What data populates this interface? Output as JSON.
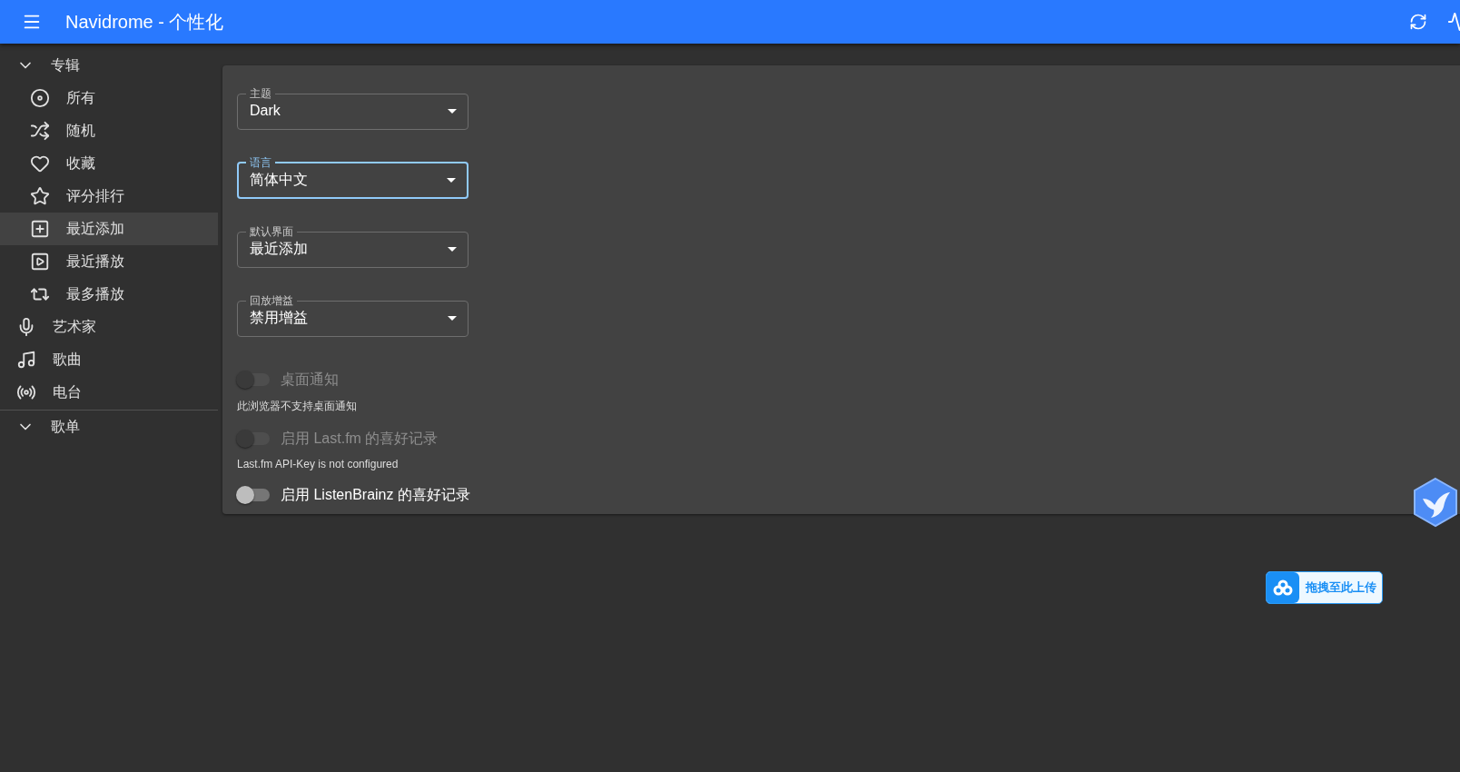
{
  "app_bar": {
    "title": "Navidrome - 个性化"
  },
  "sidebar": {
    "items": [
      {
        "label": "专辑",
        "kind": "group",
        "selected": false,
        "children": [
          {
            "label": "所有",
            "selected": false
          },
          {
            "label": "随机",
            "selected": false
          },
          {
            "label": "收藏",
            "selected": false
          },
          {
            "label": "评分排行",
            "selected": false
          },
          {
            "label": "最近添加",
            "selected": true
          },
          {
            "label": "最近播放",
            "selected": false
          },
          {
            "label": "最多播放",
            "selected": false
          }
        ]
      },
      {
        "label": "艺术家",
        "selected": false
      },
      {
        "label": "歌曲",
        "selected": false
      },
      {
        "label": "电台",
        "selected": false
      },
      {
        "label": "歌单",
        "kind": "group",
        "selected": false
      }
    ]
  },
  "settings": {
    "selects": [
      {
        "label": "主题",
        "value": "Dark",
        "focused": false
      },
      {
        "label": "语言",
        "value": "简体中文",
        "focused": true
      },
      {
        "label": "默认界面",
        "value": "最近添加",
        "focused": false
      },
      {
        "label": "回放增益",
        "value": "禁用增益",
        "focused": false
      }
    ],
    "toggles": [
      {
        "label": "桌面通知",
        "on": false,
        "disabled": true,
        "helper": "此浏览器不支持桌面通知"
      },
      {
        "label": "启用 Last.fm 的喜好记录",
        "on": false,
        "disabled": true,
        "helper": "Last.fm API-Key is not configured"
      },
      {
        "label": "启用 ListenBrainz 的喜好记录",
        "on": false,
        "disabled": false
      }
    ]
  },
  "upload_widget": {
    "label": "拖拽至此上传"
  }
}
